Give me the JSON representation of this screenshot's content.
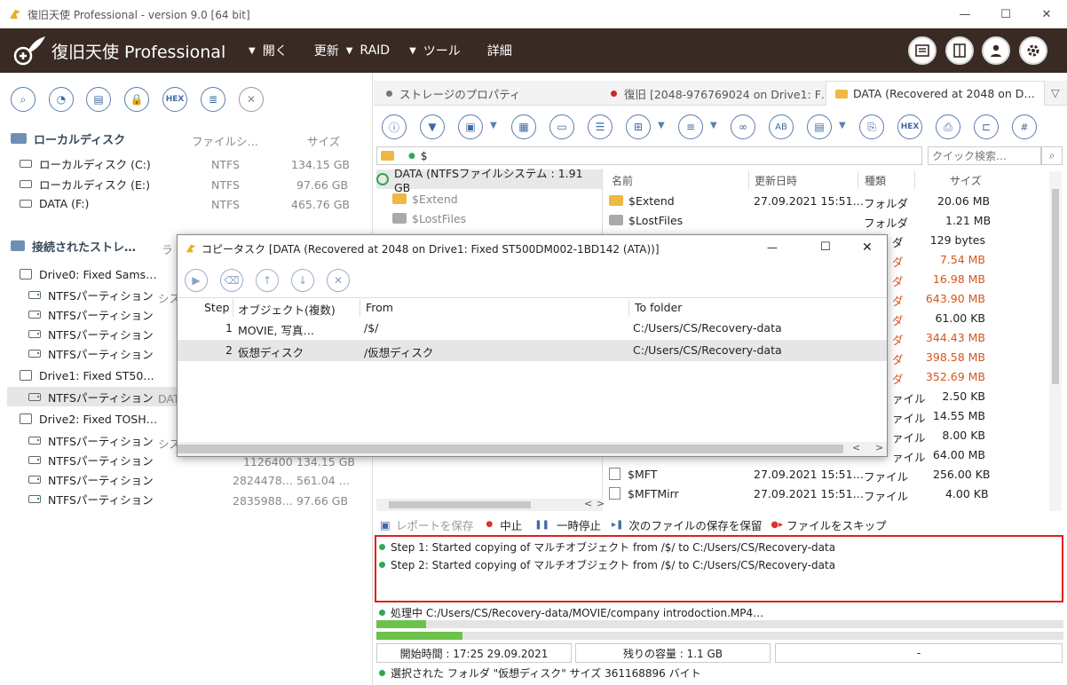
{
  "window": {
    "title": "復旧天使 Professional - version 9.0 [64 bit]"
  },
  "brand": {
    "name": "復旧天使 Professional"
  },
  "menu": [
    {
      "label": "開く",
      "arrow": "▼"
    },
    {
      "label": "更新",
      "arrow": ""
    },
    {
      "label": "RAID",
      "arrow": "▼"
    },
    {
      "label": "ツール",
      "arrow": "▼"
    },
    {
      "label": "詳細",
      "arrow": ""
    }
  ],
  "left": {
    "toolbar_hex": "HEX",
    "local": {
      "title": "ローカルディスク",
      "col_fs": "ファイルシ…",
      "col_size": "サイズ",
      "items": [
        {
          "name": "ローカルディスク (C:)",
          "fs": "NTFS",
          "size": "134.15 GB"
        },
        {
          "name": "ローカルディスク (E:)",
          "fs": "NTFS",
          "size": "97.66 GB"
        },
        {
          "name": "DATA (F:)",
          "fs": "NTFS",
          "size": "465.76 GB"
        }
      ]
    },
    "connected": {
      "title": "接続されたストレ…",
      "col2": "ラ",
      "drive0": "Drive0: Fixed Sams…",
      "drive1": "Drive1: Fixed ST50…",
      "drive2": "Drive2: Fixed TOSH…",
      "part": "NTFSパーティション",
      "sys": "シス",
      "data": "DATA",
      "p_sizes": [
        {
          "a": "1126400",
          "b": "134.15 GB"
        },
        {
          "a": "2824478…",
          "b": "561.04 …"
        },
        {
          "a": "2835988…",
          "b": "97.66 GB"
        }
      ]
    }
  },
  "tabs": [
    {
      "label": "ストレージのプロパティ",
      "color": "#777"
    },
    {
      "label": "復旧 [2048-976769024 on Drive1: F…",
      "color": "#c62828"
    },
    {
      "label": "DATA (Recovered at 2048 on D…",
      "color": "#e8a020"
    }
  ],
  "pathbar": {
    "path": "$",
    "search_placeholder": "クイック検索…"
  },
  "tree": {
    "root": "DATA (NTFSファイルシステム : 1.91 GB",
    "items": [
      "$Extend",
      "$LostFiles"
    ]
  },
  "files": {
    "headers": {
      "name": "名前",
      "date": "更新日時",
      "type": "種類",
      "size": "サイズ"
    },
    "rows": [
      {
        "name": "$Extend",
        "date": "27.09.2021 15:51…",
        "type": "フォルダ",
        "size": "20.06 MB"
      },
      {
        "name": "$LostFiles",
        "date": "",
        "type": "フォルダ",
        "size": "1.21 MB"
      }
    ],
    "partial_sizes": [
      "129 bytes",
      "7.54 MB",
      "16.98 MB",
      "643.90 MB",
      "61.00 KB",
      "344.43 MB",
      "398.58 MB",
      "352.69 MB",
      "2.50 KB",
      "14.55 MB",
      "8.00 KB",
      "64.00 MB"
    ],
    "partial_types": [
      "ダ",
      "ダ",
      "ダ",
      "ダ",
      "ダ",
      "ダ",
      "ダ",
      "ダ",
      "ァイル",
      "ァイル",
      "ァイル",
      "ァイル"
    ],
    "bottom_rows": [
      {
        "name": "$MFT",
        "date": "27.09.2021 15:51…",
        "type": "ファイル",
        "size": "256.00 KB"
      },
      {
        "name": "$MFTMirr",
        "date": "27.09.2021 15:51…",
        "type": "ファイル",
        "size": "4.00 KB"
      }
    ]
  },
  "dialog": {
    "title": "コピータスク [DATA (Recovered at 2048 on Drive1: Fixed ST500DM002-1BD142 (ATA))]",
    "headers": {
      "step": "Step",
      "obj": "オブジェクト(複数)",
      "from": "From",
      "to": "To folder"
    },
    "rows": [
      {
        "step": "1",
        "obj": "MOVIE, 写真…",
        "from": "/$/",
        "to": "C:/Users/CS/Recovery-data"
      },
      {
        "step": "2",
        "obj": "仮想ディスク",
        "from": "/仮想ディスク",
        "to": "C:/Users/CS/Recovery-data"
      }
    ]
  },
  "actions": {
    "save_report": "レポートを保存",
    "stop": "中止",
    "pause": "一時停止",
    "keep_next": "次のファイルの保存を保留",
    "skip": "ファイルをスキップ"
  },
  "log": [
    "Step 1: Started copying of マルチオブジェクト from /$/ to C:/Users/CS/Recovery-data",
    "Step 2: Started copying of マルチオブジェクト from /$/ to C:/Users/CS/Recovery-data"
  ],
  "processing": "処理中 C:/Users/CS/Recovery-data/MOVIE/company introdoction.MP4…",
  "progress": {
    "bar1": 0.072,
    "bar2": 0.125
  },
  "status": {
    "start": "開始時間 : 17:25 29.09.2021",
    "remain": "残りの容量 : 1.1 GB",
    "third": "-",
    "selected": "選択された フォルダ \"仮想ディスク\" サイズ 361168896 バイト"
  }
}
